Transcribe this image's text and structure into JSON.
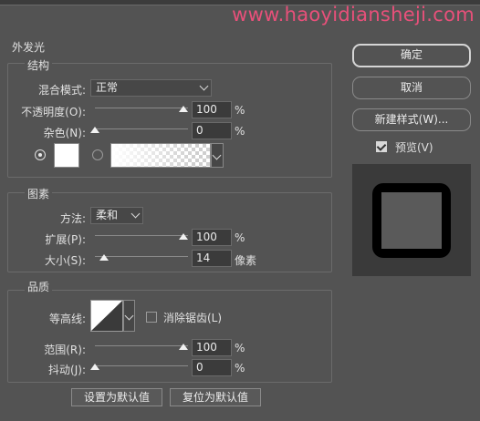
{
  "watermark": "www.haoyidiansheji.com",
  "dialog": {
    "section_title": "外发光",
    "structure": {
      "title": "结构",
      "blend_mode_label": "混合模式:",
      "blend_mode_value": "正常",
      "opacity_label": "不透明度(O):",
      "opacity_value": "100",
      "opacity_percent": 100,
      "noise_label": "杂色(N):",
      "noise_value": "0",
      "noise_percent": 0,
      "unit_percent": "%",
      "color_swatch": "#ffffff",
      "color_mode": "solid"
    },
    "elements": {
      "title": "图素",
      "method_label": "方法:",
      "method_value": "柔和",
      "spread_label": "扩展(P):",
      "spread_value": "100",
      "spread_percent": 100,
      "size_label": "大小(S):",
      "size_value": "14",
      "size_unit": "像素",
      "unit_percent": "%"
    },
    "quality": {
      "title": "品质",
      "contour_label": "等高线:",
      "anti_alias_label": "消除锯齿(L)",
      "anti_alias_checked": false,
      "range_label": "范围(R):",
      "range_value": "100",
      "range_percent": 100,
      "jitter_label": "抖动(J):",
      "jitter_value": "0",
      "jitter_percent": 0,
      "unit_percent": "%"
    },
    "buttons": {
      "set_default": "设置为默认值",
      "reset_default": "复位为默认值"
    }
  },
  "side": {
    "ok": "确定",
    "cancel": "取消",
    "new_style": "新建样式(W)...",
    "preview_label": "预览(V)",
    "preview_checked": true
  },
  "colors": {
    "background": "#535353",
    "watermark": "#e8507a",
    "preview_bg": "#3a3a3a",
    "preview_frame": "#000000",
    "preview_fill": "#5a5a5a"
  }
}
